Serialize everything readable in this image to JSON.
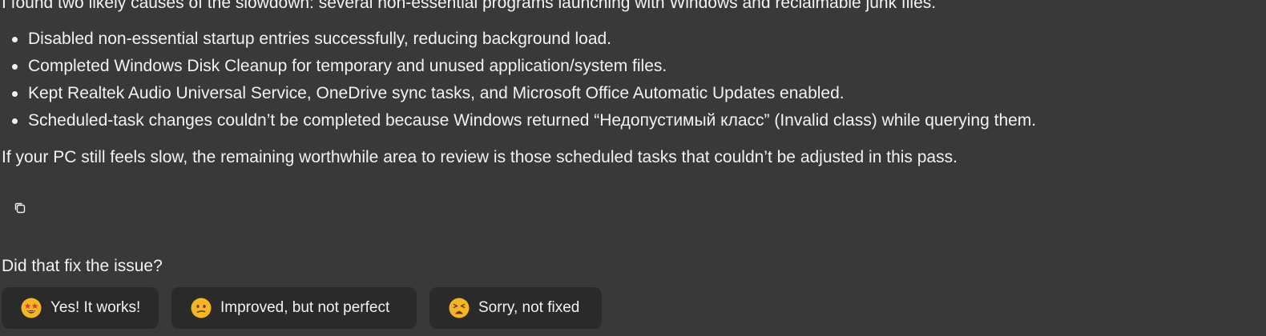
{
  "message": {
    "intro": "I found two likely causes of the slowdown: several non-essential programs launching with Windows and reclaimable junk files.",
    "bullets": [
      "Disabled non-essential startup entries successfully, reducing background load.",
      "Completed Windows Disk Cleanup for temporary and unused application/system files.",
      "Kept Realtek Audio Universal Service, OneDrive sync tasks, and Microsoft Office Automatic Updates enabled.",
      "Scheduled-task changes couldn’t be completed because Windows returned “Недопустимый класс” (Invalid class) while querying them."
    ],
    "outro": "If your PC still feels slow, the remaining worthwhile area to review is those scheduled tasks that couldn’t be adjusted in this pass."
  },
  "copy_icon": "copy-icon",
  "feedback": {
    "question": "Did that fix the issue?",
    "options": [
      {
        "label": "Yes! It works!",
        "icon": "star-struck-emoji-icon"
      },
      {
        "label": "Improved, but not perfect",
        "icon": "confused-emoji-icon"
      },
      {
        "label": "Sorry, not fixed",
        "icon": "weary-emoji-icon"
      }
    ]
  },
  "colors": {
    "background": "#393939",
    "button_background": "#2a2a2a",
    "text": "#f2f2f2",
    "emoji_yellow": "#f5b625"
  }
}
